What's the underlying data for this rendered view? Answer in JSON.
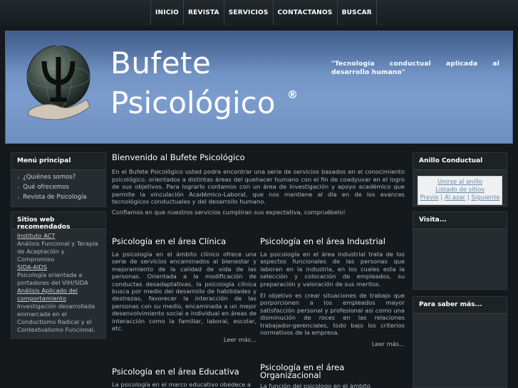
{
  "nav": {
    "items": [
      "INICIO",
      "REVISTA",
      "SERVICIOS",
      "CONTACTANOS",
      "BUSCAR"
    ]
  },
  "banner": {
    "brand_line1": "Bufete",
    "brand_line2": "Psicológico",
    "registered": "®",
    "tagline": "\"Tecnología conductual aplicada al desarrollo humano\"",
    "logo_icon": "psi-hand-globe-icon"
  },
  "left": {
    "menu": {
      "title": "Menú principal",
      "items": [
        "¿Quiénes somos?",
        "Qué ofrecemos",
        "Revista de Psicología"
      ]
    },
    "sites": {
      "title": "Sitios web recomendados",
      "entries": [
        {
          "link": "Instituto ACT",
          "desc": "Análisis Funcional y Terapia de Aceptación y Compromiso"
        },
        {
          "link": "SIDA-AIDS",
          "desc": "Psicología orientada a portadores del VIH/SIDA"
        },
        {
          "link": "Análisis Aplicado del comportamiento",
          "desc": "Investigación desarrollada enmarcada en el Conductismo Radical y el Contextualismo Funcional."
        }
      ]
    }
  },
  "right": {
    "ring": {
      "title": "Anillo Conductual",
      "join": "Unirse al anillo",
      "list": "Listado de sitios",
      "prev": "Previo",
      "random": "Al azar",
      "next": "Siguiente",
      "sep": "|"
    },
    "visita": {
      "title": "Visita..."
    },
    "saber": {
      "title": "Para saber más..."
    }
  },
  "main": {
    "welcome_title": "Bienvenido al Bufete Psicológico",
    "intro": "En el Bufete Psicológico usted podra encontrar una serie de servicios basados en el conocimiento psicológico, orientados a distintas áreas del quehacer humano con el fin de coadyuvar en el logro de sus objetivos. Para lograrlo contamos con un área de investigación y apoyo académico que permite la vinculación Académico-Laboral, que nos mantiene al día en de los avances tecnológicos conductuales y del desarrollo humano.",
    "intro2": "Confiamos en que nuestros servicios cumpliran sus expectativa, compruébelo!",
    "clinica": {
      "title": "Psicología en el área Clínica",
      "text": "La psicología en el ámbito clínico ofrece una serie de servicios encaminados al bienestar y mejoramiento de la calidad de vida de las personas. Orientada a la modificación de conductas desadaptativas, la psicología clínica busca por medio del desarrollo de habilidades y destrezas, favorecer la interacción de las personas con su medio, encaminada a un mejor desenvolvimiento social e individual en áreas de interacción como la familiar, laboral, escolar, etc.",
      "more": "Leer más..."
    },
    "industrial": {
      "title": "Psicología en el área Industrial",
      "text1": "La psicología en el área industrial trata de los aspectos funcionales de las personas que laboran en la industria, en los cuales esta la selección y colocación de empleados, su preparación y valoración de sus meritos.",
      "text2": "El objetivo es crear situaciones de trabajo que porporcionen a los empleados mayor satisfacción personal y profesional asi como una disminución de roces en las relaciones trabajador-gerenciales, todo bajo los criterios normativos de la empresa.",
      "more": "Leer más..."
    },
    "educativa": {
      "title": "Psicología en el área Educativa",
      "text": "La psicología en el marco educativo obedece a"
    },
    "organizacional": {
      "title": "Psicología en el área Organizacional",
      "text": "La función del psicologo en el ámbito"
    }
  }
}
